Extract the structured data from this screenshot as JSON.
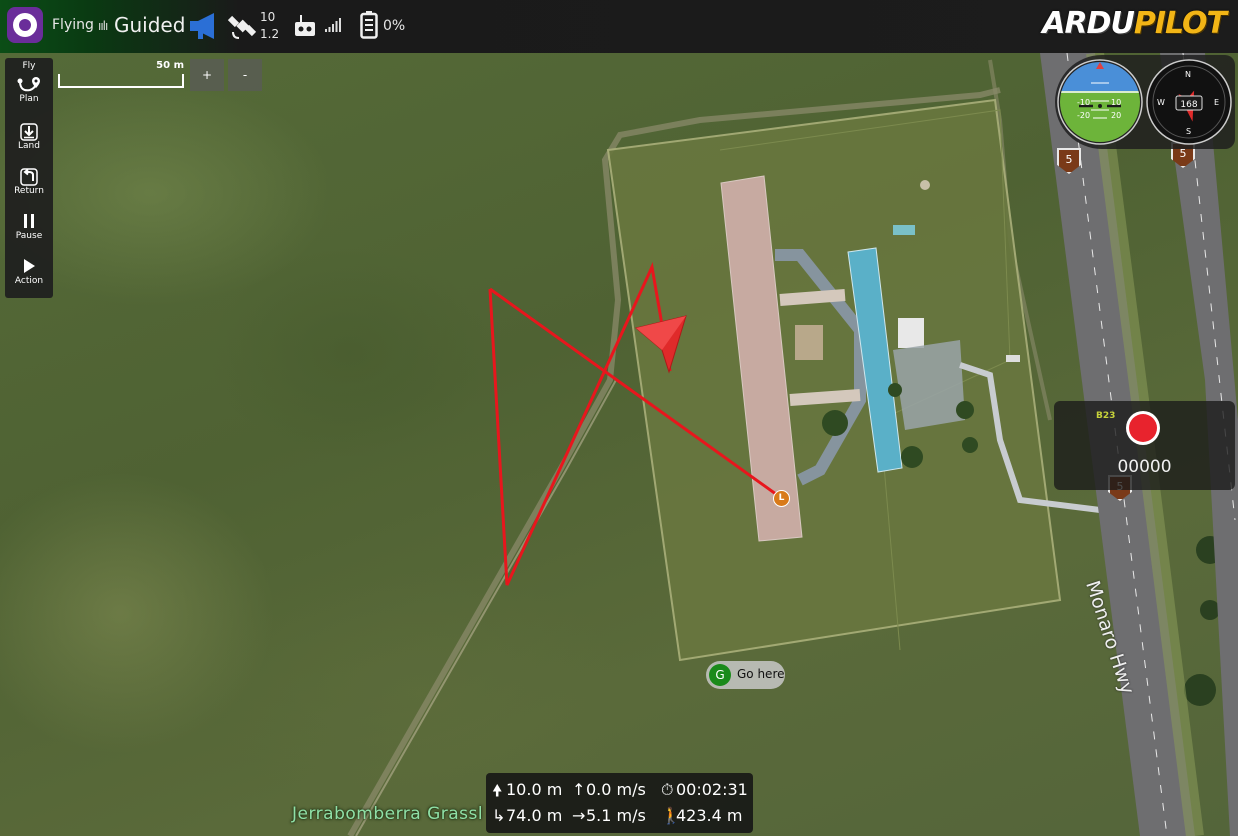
{
  "topbar": {
    "flight_state": "Flying",
    "flight_mode": "Guided",
    "gps_satellites": "10",
    "gps_hdop": "1.2",
    "battery_percent": "0%",
    "brand_a": "ARDU",
    "brand_b": "PILOT",
    "icons": [
      "qgc-logo-icon",
      "mode-icon",
      "messages-megaphone-icon",
      "gps-satellite-icon",
      "rc-transmitter-icon",
      "signal-strength-icon",
      "battery-icon"
    ]
  },
  "toolstrip": {
    "items": [
      {
        "label": "Fly",
        "icon": "fly-icon"
      },
      {
        "label": "Plan",
        "icon": "plan-route-icon"
      },
      {
        "label": "Land",
        "icon": "land-icon"
      },
      {
        "label": "Return",
        "icon": "return-icon"
      },
      {
        "label": "Pause",
        "icon": "pause-icon"
      },
      {
        "label": "Action",
        "icon": "play-icon"
      }
    ]
  },
  "map": {
    "scale_label": "50 m",
    "zoom_in": "+",
    "zoom_out": "-",
    "place_label": "Jerrabomberra Grassl",
    "road_label": "Monaro Hwy",
    "road_shield": "5",
    "road_shield_b": "B23",
    "launch_marker": "L",
    "goto_marker": "G",
    "goto_label": "Go here",
    "colors": {
      "flight_path": "#e8161d",
      "vehicle": "#e02a2a",
      "launch": "#d87a1a",
      "goto": "#1a8a1a"
    }
  },
  "instruments": {
    "attitude_labels": [
      "-10",
      "10",
      "-20",
      "20"
    ],
    "compass_heading": "168",
    "compass_labels": [
      "N",
      "E",
      "S",
      "W"
    ]
  },
  "recorder": {
    "time": "00000"
  },
  "telemetry": {
    "altitude": "10.0 m",
    "vertical_speed": "0.0 m/s",
    "flight_time": "00:02:31",
    "distance_home": "74.0 m",
    "ground_speed": "5.1 m/s",
    "total_distance": "423.4 m"
  }
}
